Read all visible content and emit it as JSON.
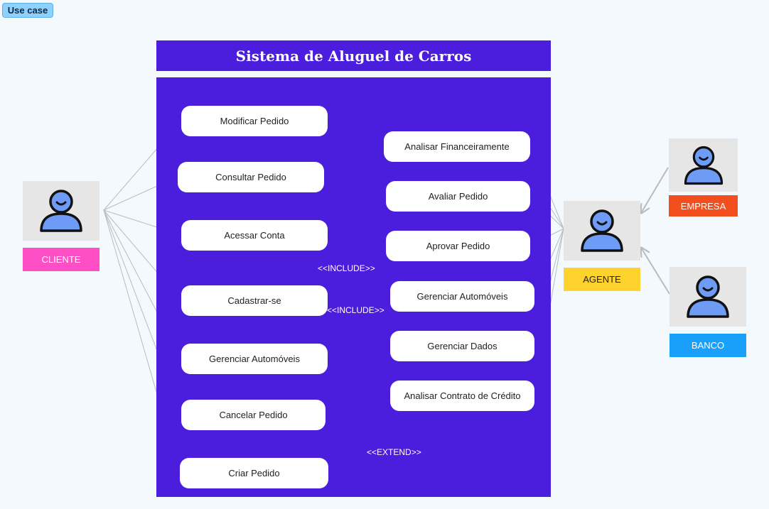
{
  "tag": "Use case",
  "system_title": "Sistema de Aluguel de Carros",
  "left_use_cases": [
    "Modificar Pedido",
    "Consultar Pedido",
    "Acessar Conta",
    "Cadastrar-se",
    "Gerenciar Automóveis",
    "Cancelar Pedido",
    "Criar Pedido"
  ],
  "right_use_cases": [
    "Analisar Financeiramente",
    "Avaliar Pedido",
    "Aprovar Pedido",
    "Gerenciar Automóveis",
    "Gerenciar Dados",
    "Analisar Contrato de Crédito"
  ],
  "actors": {
    "cliente": "CLIENTE",
    "agente": "AGENTE",
    "empresa": "EMPRESA",
    "banco": "BANCO"
  },
  "relations": {
    "include_1": "<<INCLUDE>>",
    "include_2": "<<INCLUDE>>",
    "extend": "<<EXTEND>>"
  },
  "colors": {
    "system": "#4b1ddc",
    "cliente": "#ff4fc6",
    "agente": "#ffd22e",
    "empresa": "#f24e1e",
    "banco": "#18a0fb",
    "actor_icon": "#6e9bf5"
  }
}
